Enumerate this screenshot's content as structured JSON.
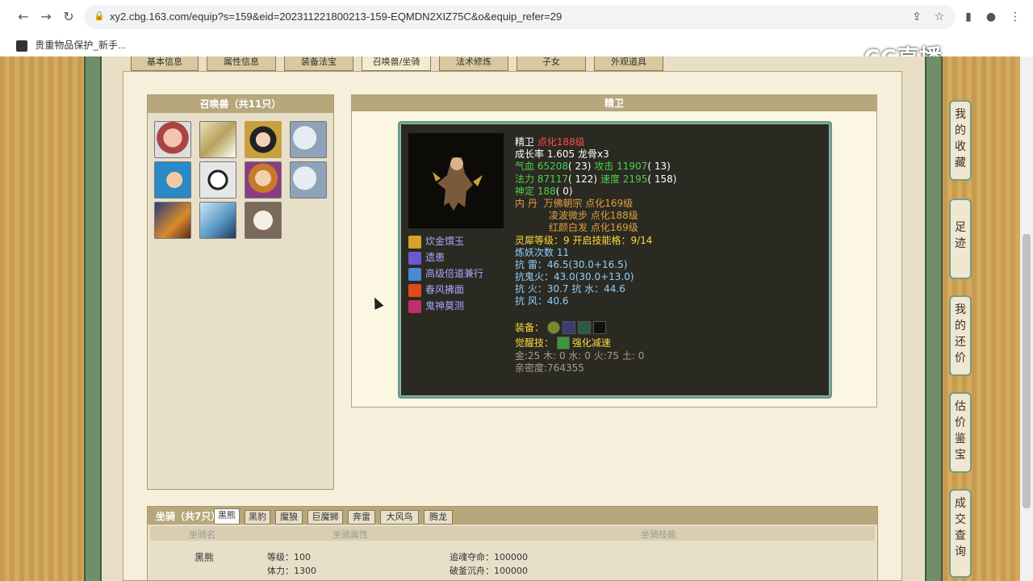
{
  "browser": {
    "url": "xy2.cbg.163.com/equip?s=159&eid=202311221800213-159-EQMDN2XIZ75C&o&equip_refer=29",
    "bookmark": "贵重物品保护_新手..."
  },
  "watermark": "CC直播",
  "page_tabs": [
    "基本信息",
    "属性信息",
    "装备法宝",
    "召唤兽/坐骑",
    "法术修炼",
    "子女",
    "外观道具"
  ],
  "summon": {
    "title": "召唤兽（共11只）",
    "pets": [
      "pet-1",
      "pet-2",
      "pet-3",
      "pet-4",
      "pet-5",
      "pet-6",
      "pet-7",
      "pet-8",
      "pet-9",
      "pet-10",
      "pet-11"
    ]
  },
  "detail": {
    "title": "精卫",
    "name": "精卫",
    "level_tag": "点化188级",
    "growth": "成长率 1.605 龙骨x3",
    "qixue_label": "气血",
    "qixue": "65208",
    "qixue_extra": "( 23)",
    "attack_label": "攻击",
    "attack": "11907",
    "attack_extra": "( 13)",
    "mana_label": "法力",
    "mana": "87117",
    "mana_extra": "( 122)",
    "speed_label": "速度",
    "speed": "2195",
    "speed_extra": "( 158)",
    "shenqi_label": "神定",
    "shenqi": "188",
    "shenqi_extra": "( 0)",
    "neidan_label": "内    丹",
    "neidan": [
      "万佛朝宗 点化169级",
      "凌波微步 点化188级",
      "红颜白发 点化169级"
    ],
    "lingxi": "灵犀等级：9 开启技能格：9/14",
    "lianyao": "炼妖次数 11",
    "resist": [
      "抗    雷：46.5(30.0+16.5)",
      "抗鬼火：43.0(30.0+13.0)",
      "抗    火：30.7 抗    水：44.6",
      "抗    风：40.6"
    ],
    "equip_label": "装备：",
    "awaken_label": "觉醒技：",
    "awaken_skill": "强化减速",
    "elements": "金:25 木: 0 水: 0 火:75 土: 0",
    "intimacy": "亲密度:764355",
    "skills": [
      "炊金馔玉",
      "遗患",
      "高级倍道兼行",
      "春风拂面",
      "鬼神莫测"
    ]
  },
  "mount": {
    "title": "坐骑（共7只）",
    "tabs": [
      "黑熊",
      "黑豹",
      "魔狼",
      "巨魔狮",
      "奔雷",
      "大风鸟",
      "腾龙"
    ],
    "col_name": "坐骑名",
    "col_attr": "坐骑属性",
    "col_skill": "坐骑技能",
    "name": "黑熊",
    "level": "等级：100",
    "stamina": "体力：1300",
    "skill_1": "追魂夺命：100000",
    "skill_2": "破釜沉舟：100000"
  },
  "side_buttons": [
    "我的收藏",
    "足迹",
    "我的还价",
    "估价鉴宝",
    "成交查询"
  ]
}
